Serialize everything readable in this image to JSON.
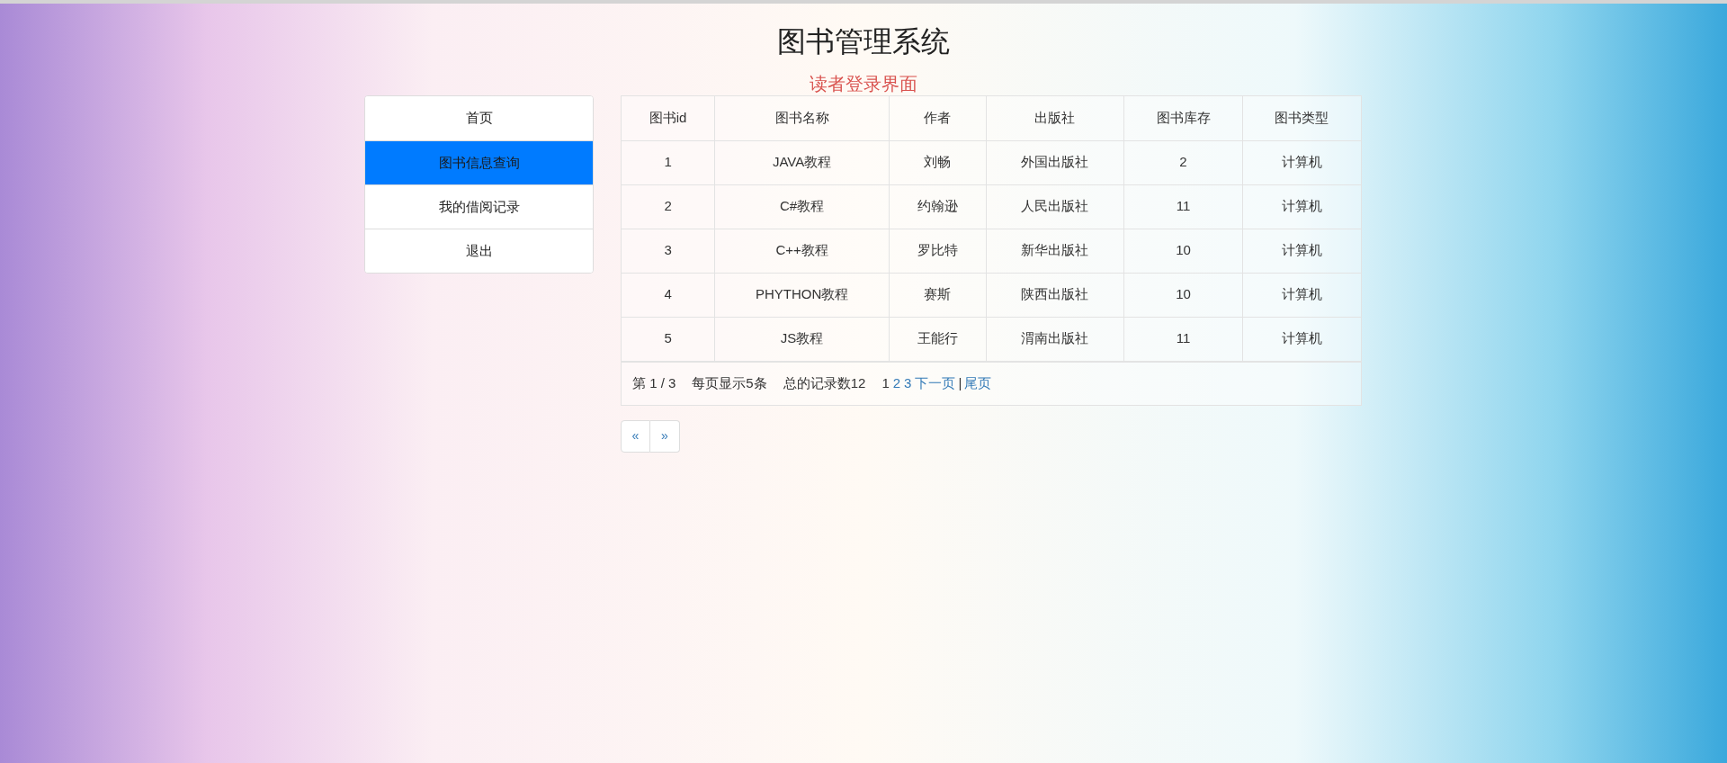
{
  "header": {
    "title": "图书管理系统",
    "subtitle": "读者登录界面"
  },
  "sidebar": {
    "items": [
      {
        "label": "首页",
        "selected": false
      },
      {
        "label": "图书信息查询",
        "selected": true
      },
      {
        "label": "我的借阅记录",
        "selected": false
      },
      {
        "label": "退出",
        "selected": false
      }
    ]
  },
  "table": {
    "columns": [
      "图书id",
      "图书名称",
      "作者",
      "出版社",
      "图书库存",
      "图书类型"
    ],
    "rows": [
      [
        "1",
        "JAVA教程",
        "刘畅",
        "外国出版社",
        "2",
        "计算机"
      ],
      [
        "2",
        "C#教程",
        "约翰逊",
        "人民出版社",
        "11",
        "计算机"
      ],
      [
        "3",
        "C++教程",
        "罗比特",
        "新华出版社",
        "10",
        "计算机"
      ],
      [
        "4",
        "PHYTHON教程",
        "赛斯",
        "陕西出版社",
        "10",
        "计算机"
      ],
      [
        "5",
        "JS教程",
        "王能行",
        "渭南出版社",
        "11",
        "计算机"
      ]
    ]
  },
  "pager": {
    "summary": [
      "第 1 / 3",
      "每页显示5条",
      "总的记录数12"
    ],
    "pages": [
      {
        "label": "1",
        "selected": true
      },
      {
        "label": "2",
        "selected": false
      },
      {
        "label": "3",
        "selected": false
      }
    ],
    "next": "下一页",
    "separator": "|",
    "last": "尾页"
  },
  "page_buttons": [
    "«",
    "»"
  ]
}
